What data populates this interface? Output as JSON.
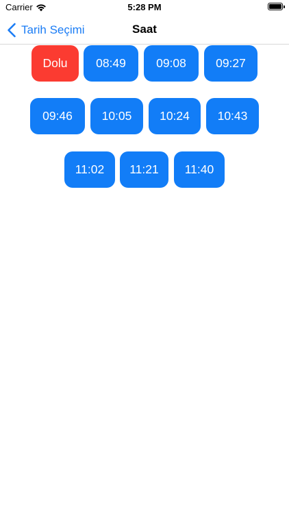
{
  "status_bar": {
    "carrier": "Carrier",
    "time": "5:28 PM",
    "wifi_icon": "wifi-icon",
    "battery_icon": "battery-icon"
  },
  "nav": {
    "back_label": "Tarih Seçimi",
    "back_icon": "chevron-left-icon",
    "title": "Saat"
  },
  "slots": [
    {
      "label": "Dolu",
      "status": "busy"
    },
    {
      "label": "08:49",
      "status": "available"
    },
    {
      "label": "09:08",
      "status": "available"
    },
    {
      "label": "09:27",
      "status": "available"
    },
    {
      "label": "09:46",
      "status": "available"
    },
    {
      "label": "10:05",
      "status": "available"
    },
    {
      "label": "10:24",
      "status": "available"
    },
    {
      "label": "10:43",
      "status": "available"
    },
    {
      "label": "11:02",
      "status": "available"
    },
    {
      "label": "11:21",
      "status": "available"
    },
    {
      "label": "11:40",
      "status": "available"
    }
  ],
  "colors": {
    "accent": "#127df7",
    "busy": "#fb3b31",
    "nav_tint": "#1a7cf5"
  }
}
